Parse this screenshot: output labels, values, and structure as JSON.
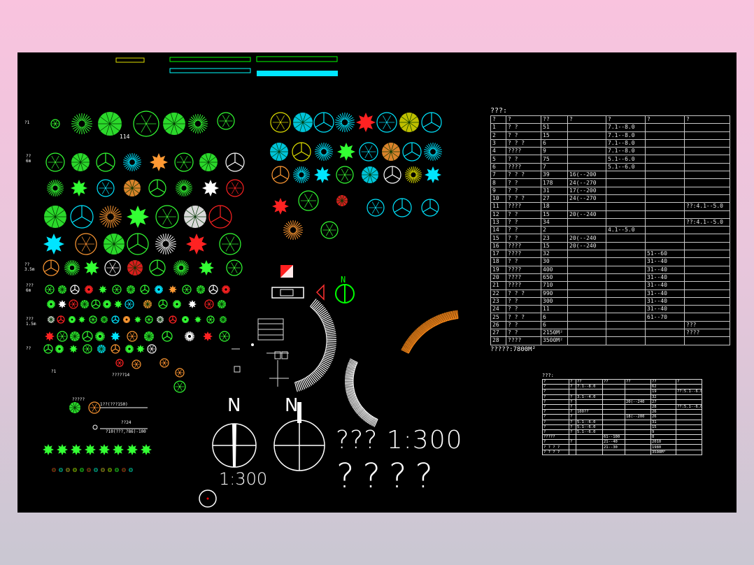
{
  "drawing": {
    "header_bars": [
      "",
      "",
      "",
      ""
    ],
    "labels": {
      "tree_tag": "114",
      "scale_text": "??? 1:300",
      "scale_under_compass": "1:300",
      "big_text": "????",
      "north_1": "N",
      "north_2": "N",
      "north_small": "N",
      "rowtag_1": "?1",
      "rowtag_2": "?? 6m",
      "rowtag_3": "?? 3.5m",
      "rowtag_4": "??? 6m",
      "rowtag_5": "??? 1.5m",
      "rowtag_6": "??",
      "rowtag_7": "?1",
      "note_1": "?????14",
      "note_2": "?????",
      "note_3": "1??(???150)",
      "note_4": "??24",
      "note_5": "?10(???,?86)-100"
    }
  },
  "table_main": {
    "title": "???:",
    "headers": [
      "?",
      "?",
      "??",
      "?",
      "?",
      "?",
      "?",
      "?"
    ],
    "rows": [
      [
        "1",
        "?  ?",
        "51",
        "",
        "7.1--8.0",
        "",
        ""
      ],
      [
        "2",
        "?  ?",
        "15",
        "",
        "7.1--8.0",
        "",
        ""
      ],
      [
        "3",
        "? ? ?",
        "6",
        "",
        "7.1--8.0",
        "",
        ""
      ],
      [
        "4",
        "????",
        "9",
        "",
        "7.1--8.0",
        "",
        ""
      ],
      [
        "5",
        "?  ?",
        "75",
        "",
        "5.1--6.0",
        "",
        ""
      ],
      [
        "6",
        "????",
        "7",
        "",
        "5.1--6.0",
        "",
        ""
      ],
      [
        "7",
        "? ? ?",
        "39",
        "16(--200",
        "",
        "",
        ""
      ],
      [
        "8",
        "?  ?",
        "178",
        "24(--270",
        "",
        "",
        ""
      ],
      [
        "9",
        "?  ?",
        "31",
        "17(--200",
        "",
        "",
        ""
      ],
      [
        "10",
        "? ? ?",
        "27",
        "24(--270",
        "",
        "",
        ""
      ],
      [
        "11",
        "????",
        "18",
        "",
        "",
        "",
        "??:4.1--5.0"
      ],
      [
        "12",
        "?  ?",
        "15",
        "20(--240",
        "",
        "",
        ""
      ],
      [
        "13",
        "?  ?",
        "34",
        "",
        "",
        "",
        "??:4.1--5.0"
      ],
      [
        "14",
        "?  ?",
        "2",
        "",
        "4.1--5.0",
        "",
        ""
      ],
      [
        "15",
        "?  ?",
        "23",
        "20(--240",
        "",
        "",
        ""
      ],
      [
        "16",
        "????",
        "15",
        "20(--240",
        "",
        "",
        ""
      ],
      [
        "17",
        "????",
        "32",
        "",
        "",
        "51--60",
        ""
      ],
      [
        "18",
        "?  ?",
        "30",
        "",
        "",
        "31--40",
        ""
      ],
      [
        "19",
        "????",
        "400",
        "",
        "",
        "31--40",
        ""
      ],
      [
        "20",
        "????",
        "650",
        "",
        "",
        "31--40",
        ""
      ],
      [
        "21",
        "????",
        "710",
        "",
        "",
        "31--40",
        ""
      ],
      [
        "22",
        "? ? ?",
        "990",
        "",
        "",
        "31--40",
        ""
      ],
      [
        "23",
        "?  ?",
        "300",
        "",
        "",
        "31--40",
        ""
      ],
      [
        "24",
        "?  ?",
        "11",
        "",
        "",
        "31--40",
        ""
      ],
      [
        "25",
        "? ? ?",
        "6",
        "",
        "",
        "61--70",
        ""
      ],
      [
        "26",
        "?  ?",
        "6",
        "",
        "",
        "",
        "???"
      ],
      [
        "27",
        "?  ?",
        "2150M²",
        "",
        "",
        "",
        "????"
      ],
      [
        "28",
        "????",
        "3500M²",
        "",
        "",
        "",
        ""
      ]
    ],
    "footer": "?????:7800M²"
  },
  "table_small": {
    "title": "???:",
    "headers": [
      "?",
      "?",
      "??",
      "??",
      "??",
      "??",
      "?"
    ],
    "rows": [
      [
        "?",
        "?",
        "7.1--8.0",
        "",
        "",
        "62",
        ""
      ],
      [
        "?",
        "",
        "",
        "",
        "",
        "19",
        "??:5.1--6.0"
      ],
      [
        "?",
        "?",
        "3.1--4.0",
        "",
        "",
        "32",
        ""
      ],
      [
        "?",
        "? ? ?",
        "",
        "",
        "20(--240",
        "27",
        ""
      ],
      [
        "?",
        "? ? ?",
        "",
        "",
        "",
        "28",
        "??:5.1--6.0"
      ],
      [
        "?",
        "?",
        "100??",
        "",
        "",
        "26",
        ""
      ],
      [
        "?",
        "?",
        "",
        "",
        "18(--200",
        "26",
        ""
      ],
      [
        "?",
        "?",
        "5.1--6.0",
        "",
        "",
        "31",
        ""
      ],
      [
        "?",
        "?",
        "5.1--6.0",
        "",
        "",
        "15",
        ""
      ],
      [
        "?",
        "?",
        "5.1--6.0",
        "",
        "",
        "9",
        ""
      ],
      [
        "?????",
        "",
        "",
        "61--100",
        "",
        "8",
        ""
      ],
      [
        "?",
        "?",
        "",
        "21--40",
        "",
        "2010",
        ""
      ],
      [
        "? ? ? ?",
        "",
        "",
        "21--30",
        "",
        "1980",
        ""
      ],
      [
        "? ? ? ?",
        "",
        "",
        "",
        "",
        "3500M²",
        ""
      ]
    ]
  }
}
